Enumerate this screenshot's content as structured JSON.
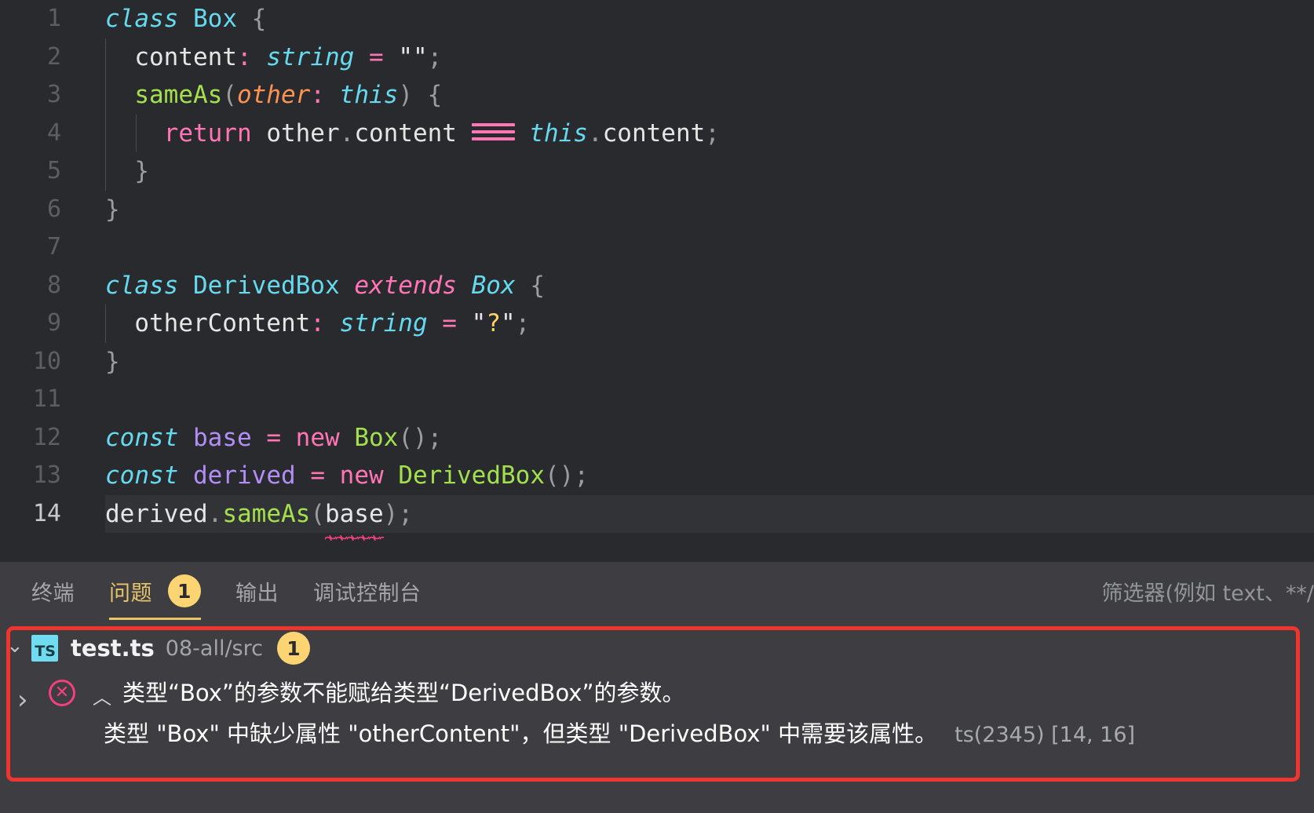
{
  "editor": {
    "lines": [
      {
        "num": "1",
        "indent": 0,
        "active": false
      },
      {
        "num": "2",
        "indent": 1,
        "active": false
      },
      {
        "num": "3",
        "indent": 1,
        "active": false
      },
      {
        "num": "4",
        "indent": 2,
        "active": false
      },
      {
        "num": "5",
        "indent": 1,
        "active": false
      },
      {
        "num": "6",
        "indent": 0,
        "active": false
      },
      {
        "num": "7",
        "indent": 0,
        "active": false
      },
      {
        "num": "8",
        "indent": 0,
        "active": false
      },
      {
        "num": "9",
        "indent": 1,
        "active": false
      },
      {
        "num": "10",
        "indent": 0,
        "active": false
      },
      {
        "num": "11",
        "indent": 0,
        "active": false
      },
      {
        "num": "12",
        "indent": 0,
        "active": false
      },
      {
        "num": "13",
        "indent": 0,
        "active": false
      },
      {
        "num": "14",
        "indent": 0,
        "active": true
      }
    ],
    "line_numbers": {
      "l1": "1",
      "l2": "2",
      "l3": "3",
      "l4": "4",
      "l5": "5",
      "l6": "6",
      "l7": "7",
      "l8": "8",
      "l9": "9",
      "l10": "10",
      "l11": "11",
      "l12": "12",
      "l13": "13",
      "l14": "14"
    },
    "code": {
      "l1_class": "class",
      "l1_name": "Box",
      "l1_brace": "{",
      "l2_prop": "content",
      "l2_colon": ":",
      "l2_type": "string",
      "l2_eq": "=",
      "l2_value": "\"\"",
      "l2_semi": ";",
      "l3_fn": "sameAs",
      "l3_paren_open": "(",
      "l3_param": "other",
      "l3_colon": ":",
      "l3_this": "this",
      "l3_paren_close": ")",
      "l3_brace": "{",
      "l4_return": "return",
      "l4_obj": "other",
      "l4_dot": ".",
      "l4_prop": "content",
      "l4_op": "===",
      "l4_this": "this",
      "l4_dot2": ".",
      "l4_prop2": "content",
      "l4_semi": ";",
      "l5_brace": "}",
      "l6_brace": "}",
      "l8_class": "class",
      "l8_name": "DerivedBox",
      "l8_extends": "extends",
      "l8_base": "Box",
      "l8_brace": "{",
      "l9_prop": "otherContent",
      "l9_colon": ":",
      "l9_type": "string",
      "l9_eq": "=",
      "l9_q1": "\"",
      "l9_value": "?",
      "l9_q2": "\"",
      "l9_semi": ";",
      "l10_brace": "}",
      "l12_const": "const",
      "l12_var": "base",
      "l12_eq": "=",
      "l12_new": "new",
      "l12_cls": "Box",
      "l12_call": "()",
      "l12_semi": ";",
      "l13_const": "const",
      "l13_var": "derived",
      "l13_eq": "=",
      "l13_new": "new",
      "l13_cls": "DerivedBox",
      "l13_call": "()",
      "l13_semi": ";",
      "l14_obj": "derived",
      "l14_dot": ".",
      "l14_fn": "sameAs",
      "l14_paren_open": "(",
      "l14_arg": "base",
      "l14_paren_close": ")",
      "l14_semi": ";"
    }
  },
  "panel": {
    "tabs": [
      {
        "label": "终端",
        "active": false,
        "badge": null
      },
      {
        "label": "问题",
        "active": true,
        "badge": "1"
      },
      {
        "label": "输出",
        "active": false,
        "badge": null
      },
      {
        "label": "调试控制台",
        "active": false,
        "badge": null
      }
    ],
    "tab_terminal": "终端",
    "tab_problems": "问题",
    "tab_problems_badge": "1",
    "tab_output": "输出",
    "tab_debug_console": "调试控制台",
    "filter_placeholder": "筛选器(例如 text、**/"
  },
  "problems": {
    "file_icon_label": "TS",
    "file_name": "test.ts",
    "file_path": "08-all/src",
    "file_badge": "1",
    "twisty_file": "⌄",
    "twisty_group": "›",
    "error_icon": "✕",
    "collapse_chevron": "︿",
    "message_line1": "类型“Box”的参数不能赋给类型“DerivedBox”的参数。",
    "message_line2": "类型 \"Box\" 中缺少属性 \"otherContent\"，但类型 \"DerivedBox\" 中需要该属性。",
    "error_code": "ts(2345) [14, 16]"
  },
  "colors": {
    "editor_bg": "#292a2d",
    "panel_bg": "#3d3d42",
    "accent_yellow": "#e8c56a",
    "badge_yellow": "#fcd572",
    "error_red": "#f0342e",
    "error_pink": "#f2417d",
    "ts_blue": "#6fdcf0"
  }
}
